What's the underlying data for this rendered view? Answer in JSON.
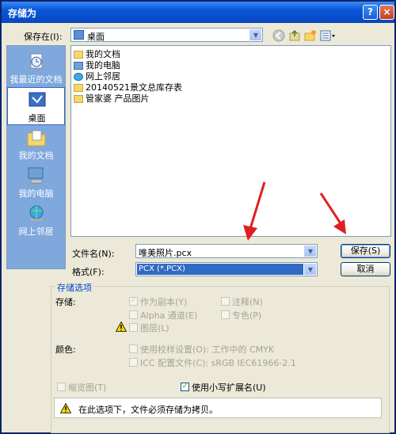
{
  "window": {
    "title": "存储为"
  },
  "save_in": {
    "label": "保存在(I):",
    "value": "桌面"
  },
  "places": [
    {
      "label": "我最近的文档",
      "icon": "recent-documents-icon"
    },
    {
      "label": "桌面",
      "icon": "desktop-icon"
    },
    {
      "label": "我的文档",
      "icon": "my-documents-icon"
    },
    {
      "label": "我的电脑",
      "icon": "my-computer-icon"
    },
    {
      "label": "网上邻居",
      "icon": "network-places-icon"
    }
  ],
  "files": [
    {
      "name": "我的文档",
      "icon": "document-folder-icon"
    },
    {
      "name": "我的电脑",
      "icon": "computer-icon"
    },
    {
      "name": "网上邻居",
      "icon": "network-icon"
    },
    {
      "name": "20140521景文总库存表",
      "icon": "folder-icon"
    },
    {
      "name": "管家婆 产品图片",
      "icon": "folder-icon"
    }
  ],
  "filename": {
    "label": "文件名(N):",
    "value": "唯美照片.pcx"
  },
  "format": {
    "label": "格式(F):",
    "value": "PCX (*.PCX)"
  },
  "buttons": {
    "save": "保存(S)",
    "cancel": "取消"
  },
  "options": {
    "group_title": "存储选项",
    "storage_label": "存储:",
    "as_copy": "作为副本(Y)",
    "notes": "注释(N)",
    "alpha": "Alpha 通道(E)",
    "spot": "专色(P)",
    "layers": "图层(L)",
    "color_label": "颜色:",
    "proof": "使用校样设置(O):  工作中的 CMYK",
    "icc": "ICC 配置文件(C):  sRGB IEC61966-2.1",
    "thumbnail": "缩览图(T)",
    "lowercase": "使用小写扩展名(U)",
    "warning": "在此选项下，文件必须存储为拷贝。"
  },
  "accent_colors": {
    "titlebar": "#0a4fd0",
    "arrow": "#e02020",
    "group_title": "#0046d5"
  }
}
